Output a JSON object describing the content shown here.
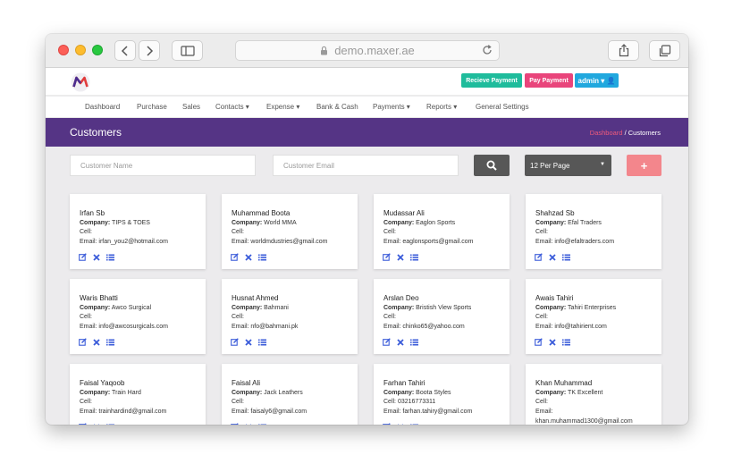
{
  "browser": {
    "url": "demo.maxer.ae"
  },
  "header": {
    "receive_payment": "Recieve Payment",
    "pay_payment": "Pay Payment",
    "admin": "admin ▾ 👤"
  },
  "nav": [
    "Dashboard",
    "Purchase",
    "Sales",
    "Contacts ▾",
    "Expense ▾",
    "Bank & Cash",
    "Payments ▾",
    "Reports ▾",
    "General Settings"
  ],
  "page": {
    "title": "Customers",
    "breadcrumb_home": "Dashboard",
    "breadcrumb_current": " / Customers"
  },
  "filters": {
    "name_placeholder": "Customer Name",
    "email_placeholder": "Customer Email",
    "per_page": "12 Per Page",
    "add_label": "+"
  },
  "labels": {
    "company": "Company:",
    "cell": "Cell:",
    "email": "Email:"
  },
  "colors": {
    "title_bar": "#553485",
    "receive": "#1fbc9c",
    "pay": "#e9457b",
    "admin": "#21a8de",
    "action_icons": "#3a5bd9"
  },
  "customers": [
    {
      "name": "Irfan Sb",
      "company": " TIPS & TOES",
      "cell": "",
      "email": " irfan_you2@hotmail.com"
    },
    {
      "name": "Muhammad Boota",
      "company": " World MMA",
      "cell": "",
      "email": " worldmdustries@gmail.com"
    },
    {
      "name": "Mudassar Ali",
      "company": " Eaglon Sports",
      "cell": "",
      "email": " eaglonsports@gmail.com"
    },
    {
      "name": "Shahzad Sb",
      "company": " Efal Traders",
      "cell": "",
      "email": " info@efaltraders.com"
    },
    {
      "name": "Waris Bhatti",
      "company": " Awco Surgical",
      "cell": "",
      "email": " info@awcosurgicals.com"
    },
    {
      "name": "Husnat Ahmed",
      "company": " Bahmani",
      "cell": "",
      "email": " nfo@bahmani.pk"
    },
    {
      "name": "Arslan Deo",
      "company": " Bristish View Sports",
      "cell": "",
      "email": " chinko65@yahoo.com"
    },
    {
      "name": "Awais Tahiri",
      "company": " Tahiri Enterprises",
      "cell": "",
      "email": " info@tahirient.com"
    },
    {
      "name": "Faisal Yaqoob",
      "company": " Train Hard",
      "cell": "",
      "email": " trainhardind@gmail.com"
    },
    {
      "name": "Faisal Ali",
      "company": " Jack Leathers",
      "cell": "",
      "email": " faisaly6@gmail.com"
    },
    {
      "name": "Farhan Tahiri",
      "company": " Boota Styles",
      "cell": " 03216773311",
      "email": " farhan.tahiry@gmail.com"
    },
    {
      "name": "Khan Muhammad",
      "company": " TK Excellent",
      "cell": "",
      "email": ""
    }
  ],
  "extra": {
    "khan_email": "khan.muhammad1300@gmail.com"
  }
}
